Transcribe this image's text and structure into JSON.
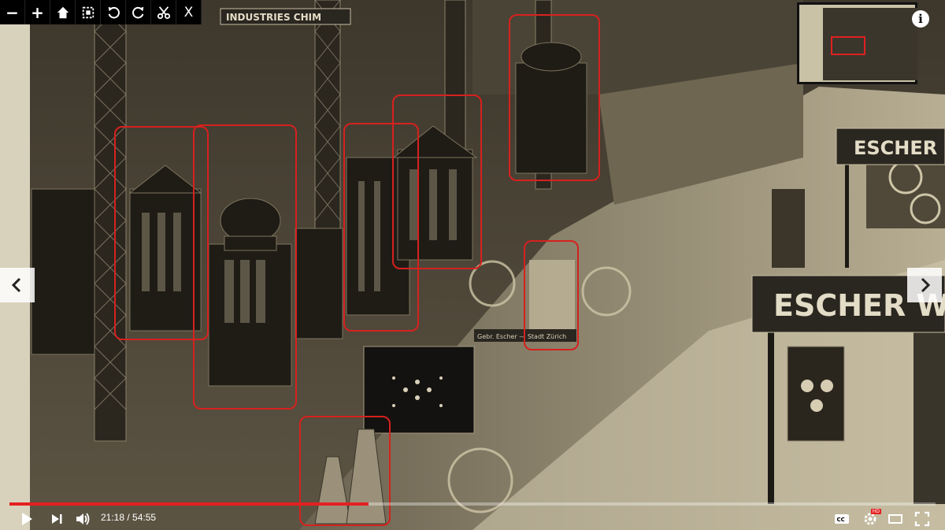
{
  "toolbar": {
    "zoom_out": "−",
    "zoom_in": "+",
    "close": "X"
  },
  "scene": {
    "sign_escher_top": "ESCHER",
    "sign_escher_bottom": "ESCHER WY",
    "sign_industries": "INDUSTRIES CHIM",
    "plaque_zurich": "Gebr. Escher — Stadt Zürich"
  },
  "player": {
    "time_current": "21:18",
    "time_total": "54:55",
    "time_separator": " / ",
    "progress": 0.388
  },
  "colors": {
    "highlight": "#d6211e",
    "progress": "#e52020",
    "photo_tone": "#5a5241"
  },
  "icons": [
    "zoom-out-icon",
    "zoom-in-icon",
    "home-icon",
    "fullpage-icon",
    "rotate-left-icon",
    "rotate-right-icon",
    "scissors-icon",
    "close-icon",
    "info-icon",
    "chevron-left-icon",
    "chevron-right-icon",
    "play-icon",
    "next-icon",
    "volume-icon",
    "captions-icon",
    "settings-icon",
    "theater-icon",
    "fullscreen-icon"
  ]
}
